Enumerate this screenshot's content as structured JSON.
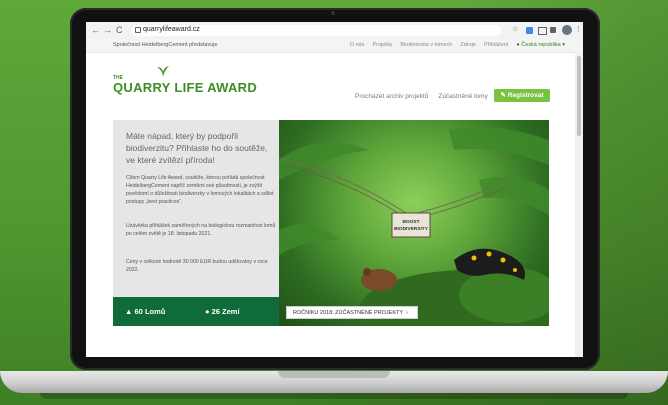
{
  "browser": {
    "url": "quarrylifeaward.cz",
    "back_icon": "←",
    "forward_icon": "→",
    "reload_icon": "C",
    "star_icon": "☆",
    "menu_icon": "⋮"
  },
  "topbar": {
    "left_text": "Společnost HeidelbergCement představuje",
    "links": [
      "O nás",
      "Projekty",
      "Biodiverzita v lomech",
      "Zdroje",
      "Přihlášení"
    ],
    "language": "Česká republika"
  },
  "header": {
    "logo_the": "THE",
    "logo_text": "QUARRY LIFE AWARD",
    "nav_items": [
      "Procházet archiv projektů",
      "Zúčastněné lomy"
    ],
    "register_label": "Registrovat"
  },
  "hero": {
    "title": "Máte nápad, který by podpořil biodiverzitu? Přihlaste ho do soutěže, ve které zvítězí příroda!",
    "p1": "Cílem Quarry Life Award, soutěže, kterou pořádá společnost HeidelbergCement napříč zeměmi své působnosti, je zvýšit povědomí o důležitosti biodiverzity v lomových lokalitách a sdílet postupy „best practices“.",
    "p2": "Uzávěrka přihlášek zaměřených na biologickou rozmanitost lomů po celém světě je 18. listopadu 2021.",
    "p3": "Ceny v celkové hodnotě 30 000 EUR budou udělovány v roce 2022.",
    "stat_quarries": "60 Lomů",
    "stat_countries": "26 Zemí",
    "sign_text": "BOOST BIODIVERSITY",
    "cta_label": "ROČNÍKU 2018: ZÚČASTNĚNÉ PROJEKTY"
  },
  "colors": {
    "brand_green": "#3d8e22",
    "stats_bg": "#0f6b3a",
    "button_green": "#7cc241"
  }
}
